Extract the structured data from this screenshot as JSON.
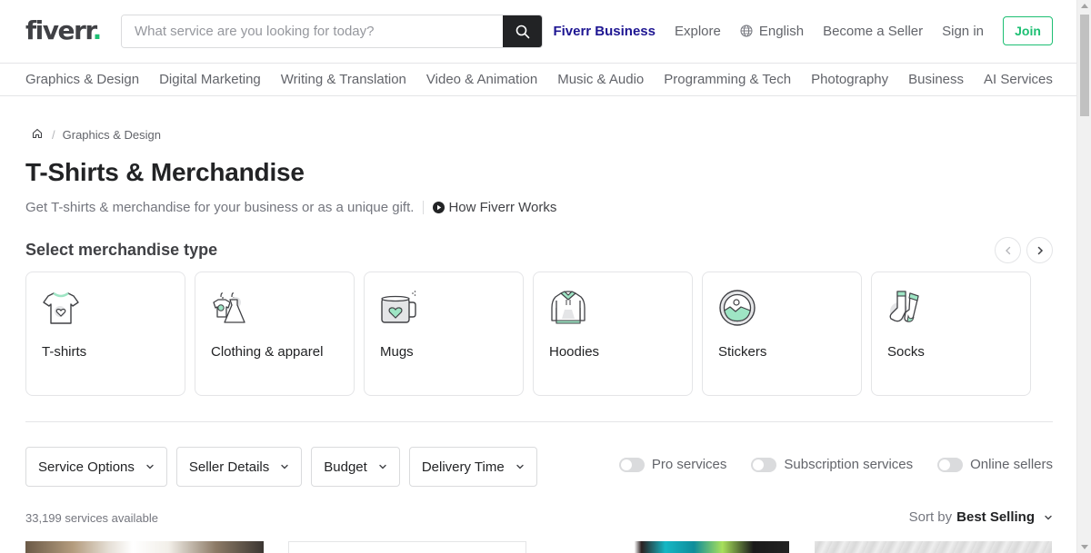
{
  "header": {
    "logo_text": "fiverr",
    "logo_dot": ".",
    "search_placeholder": "What service are you looking for today?",
    "search_value": "",
    "nav": {
      "business": "Fiverr Business",
      "explore": "Explore",
      "language": "English",
      "become_seller": "Become a Seller",
      "sign_in": "Sign in",
      "join": "Join"
    }
  },
  "categories": [
    "Graphics & Design",
    "Digital Marketing",
    "Writing & Translation",
    "Video & Animation",
    "Music & Audio",
    "Programming & Tech",
    "Photography",
    "Business",
    "AI Services"
  ],
  "breadcrumb": {
    "home_icon": "home-icon",
    "separator": "/",
    "items": [
      "Graphics & Design"
    ]
  },
  "page": {
    "title": "T-Shirts & Merchandise",
    "subtitle": "Get T-shirts & merchandise for your business or as a unique gift.",
    "how_works": "How Fiverr Works"
  },
  "merch": {
    "title": "Select merchandise type",
    "items": [
      {
        "label": "T-shirts",
        "icon": "tshirt-icon"
      },
      {
        "label": "Clothing & apparel",
        "icon": "clothing-icon"
      },
      {
        "label": "Mugs",
        "icon": "mug-icon"
      },
      {
        "label": "Hoodies",
        "icon": "hoodie-icon"
      },
      {
        "label": "Stickers",
        "icon": "sticker-icon"
      },
      {
        "label": "Socks",
        "icon": "socks-icon"
      }
    ]
  },
  "filters": [
    "Service Options",
    "Seller Details",
    "Budget",
    "Delivery Time"
  ],
  "toggles": [
    {
      "label": "Pro services",
      "on": false
    },
    {
      "label": "Subscription services",
      "on": false
    },
    {
      "label": "Online sellers",
      "on": false
    }
  ],
  "results": {
    "count": "33,199 services available",
    "sort_label": "Sort by",
    "sort_value": "Best Selling"
  },
  "colors": {
    "brand_green": "#1dbf73",
    "business_blue": "#1e1692",
    "accent_mint": "#9ee5c4"
  }
}
